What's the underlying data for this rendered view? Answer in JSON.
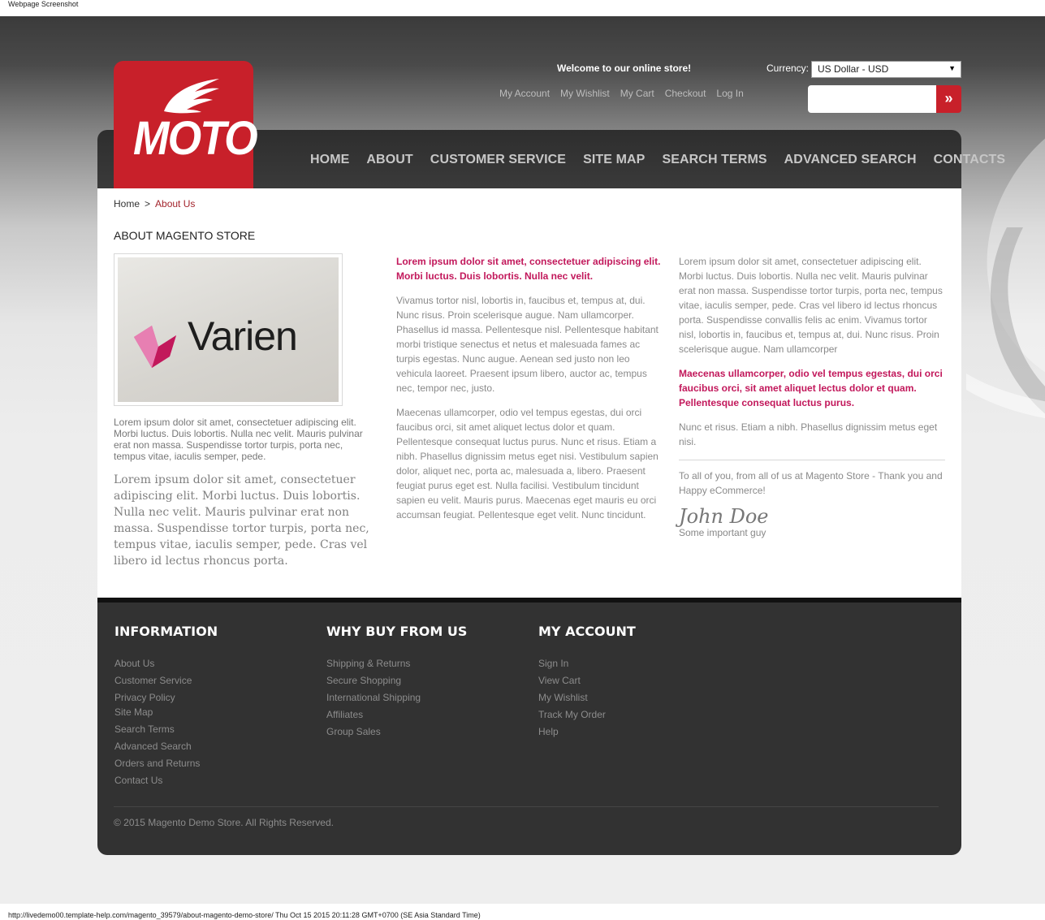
{
  "caption_top": "Webpage Screenshot",
  "caption_bottom": "http://livedemo00.template-help.com/magento_39579/about-magento-demo-store/ Thu Oct 15 2015 20:11:28 GMT+0700 (SE Asia Standard Time)",
  "header": {
    "logo_text": "MOTO",
    "welcome": "Welcome to our online store!",
    "top_links": [
      "My Account",
      "My Wishlist",
      "My Cart",
      "Checkout",
      "Log In"
    ],
    "currency_label": "Currency:",
    "currency_value": "US Dollar - USD",
    "search_value": "",
    "search_button_glyph": "»"
  },
  "nav": [
    "HOME",
    "ABOUT",
    "CUSTOMER SERVICE",
    "SITE MAP",
    "SEARCH TERMS",
    "ADVANCED SEARCH",
    "CONTACTS"
  ],
  "breadcrumb": {
    "home": "Home",
    "separator": ">",
    "current": "About Us"
  },
  "page_title": "ABOUT MAGENTO STORE",
  "image_text": "Varien",
  "col1": {
    "small": "Lorem ipsum dolor sit amet, consectetuer adipiscing elit. Morbi luctus. Duis lobortis. Nulla nec velit. Mauris pulvinar erat non massa. Suspendisse tortor turpis, porta nec, tempus vitae, iaculis semper, pede.",
    "serif": "Lorem ipsum dolor sit amet, consectetuer adipiscing elit. Morbi luctus. Duis lobortis. Nulla nec velit. Mauris pulvinar erat non massa. Suspendisse tortor turpis, porta nec, tempus vitae, iaculis semper, pede. Cras vel libero id lectus rhoncus porta."
  },
  "col2": {
    "highlight": "Lorem ipsum dolor sit amet, consectetuer adipiscing elit. Morbi luctus. Duis lobortis. Nulla nec velit.",
    "para1": "Vivamus tortor nisl, lobortis in, faucibus et, tempus at, dui. Nunc risus. Proin scelerisque augue. Nam ullamcorper. Phasellus id massa. Pellentesque nisl. Pellentesque habitant morbi tristique senectus et netus et malesuada fames ac turpis egestas. Nunc augue. Aenean sed justo non leo vehicula laoreet. Praesent ipsum libero, auctor ac, tempus nec, tempor nec, justo.",
    "para2": "Maecenas ullamcorper, odio vel tempus egestas, dui orci faucibus orci, sit amet aliquet lectus dolor et quam. Pellentesque consequat luctus purus. Nunc et risus. Etiam a nibh. Phasellus dignissim metus eget nisi. Vestibulum sapien dolor, aliquet nec, porta ac, malesuada a, libero. Praesent feugiat purus eget est. Nulla facilisi. Vestibulum tincidunt sapien eu velit. Mauris purus. Maecenas eget mauris eu orci accumsan feugiat. Pellentesque eget velit. Nunc tincidunt."
  },
  "col3": {
    "para1": "Lorem ipsum dolor sit amet, consectetuer adipiscing elit. Morbi luctus. Duis lobortis. Nulla nec velit. Mauris pulvinar erat non massa. Suspendisse tortor turpis, porta nec, tempus vitae, iaculis semper, pede. Cras vel libero id lectus rhoncus porta. Suspendisse convallis felis ac enim. Vivamus tortor nisl, lobortis in, faucibus et, tempus at, dui. Nunc risus. Proin scelerisque augue. Nam ullamcorper",
    "highlight": "Maecenas ullamcorper, odio vel tempus egestas, dui orci faucibus orci, sit amet aliquet lectus dolor et quam. Pellentesque consequat luctus purus.",
    "para2": "Nunc et risus. Etiam a nibh. Phasellus dignissim metus eget nisi.",
    "thanks": "To all of you, from all of us at Magento Store - Thank you and Happy eCommerce!",
    "signature": "John Doe",
    "signature_sub": "Some important guy"
  },
  "footer": {
    "information": {
      "title": "INFORMATION",
      "links": [
        "About Us",
        "Customer Service",
        "Privacy Policy",
        "Site Map",
        "Search Terms",
        "Advanced Search",
        "Orders and Returns",
        "Contact Us"
      ]
    },
    "why_buy": {
      "title": "WHY BUY FROM US",
      "links": [
        "Shipping & Returns",
        "Secure Shopping",
        "International Shipping",
        "Affiliates",
        "Group Sales"
      ]
    },
    "my_account": {
      "title": "MY ACCOUNT",
      "links": [
        "Sign In",
        "View Cart",
        "My Wishlist",
        "Track My Order",
        "Help"
      ]
    },
    "copyright": "© 2015 Magento Demo Store. All Rights Reserved."
  },
  "colors": {
    "brand_red": "#c8202a",
    "highlight_pink": "#c2185b",
    "footer_bg": "#323232"
  }
}
